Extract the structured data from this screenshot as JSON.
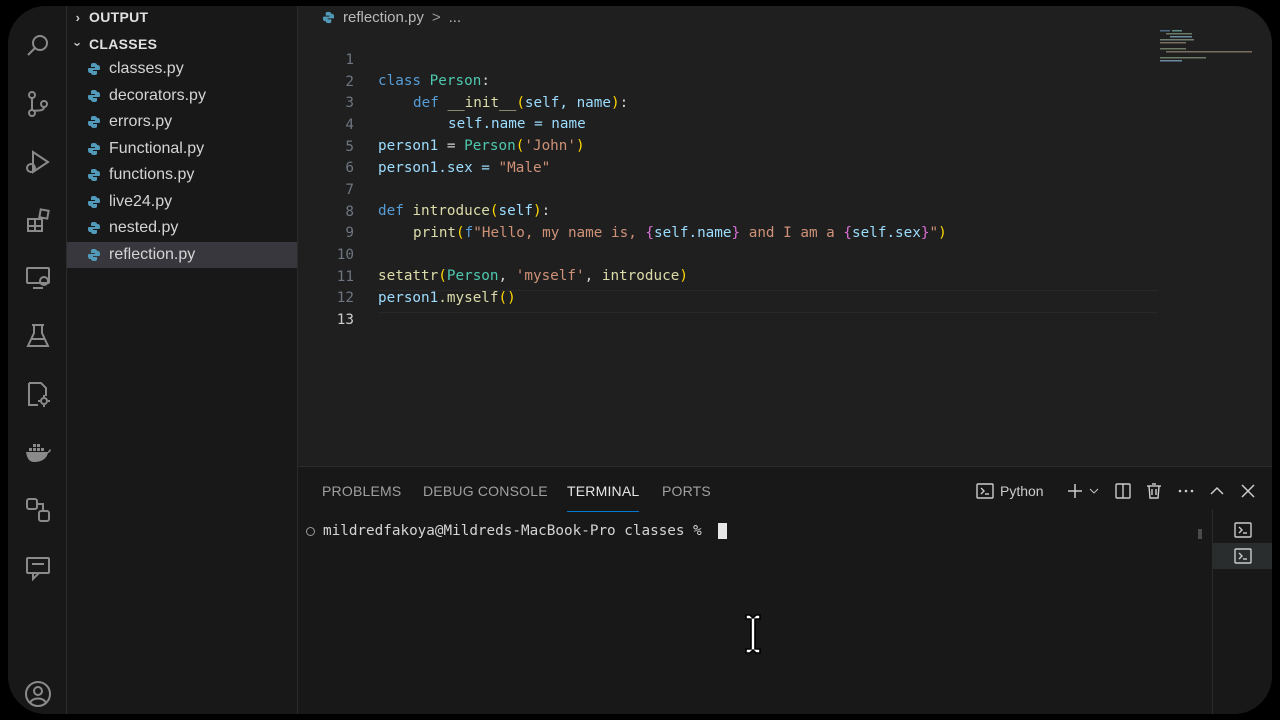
{
  "colors": {
    "background": "#1f1f1f",
    "sidebar": "#181818",
    "selection": "#37373d",
    "accent": "#0078d4",
    "python_icon": "#519aba"
  },
  "activity_bar": {
    "icons": [
      "search-icon",
      "source-control-icon",
      "run-debug-icon",
      "extensions-icon",
      "remote-explorer-icon",
      "testing-icon",
      "settings-sync-icon",
      "docker-icon",
      "live-share-icon",
      "chat-icon",
      "account-icon"
    ]
  },
  "sidebar": {
    "sections": [
      {
        "label": "OUTPUT",
        "expanded": false
      },
      {
        "label": "CLASSES",
        "expanded": true
      }
    ],
    "files": [
      {
        "label": "classes.py"
      },
      {
        "label": "decorators.py"
      },
      {
        "label": "errors.py"
      },
      {
        "label": "Functional.py"
      },
      {
        "label": "functions.py"
      },
      {
        "label": "live24.py"
      },
      {
        "label": "nested.py"
      },
      {
        "label": "reflection.py",
        "active": true
      }
    ]
  },
  "editor": {
    "breadcrumb": {
      "file": "reflection.py",
      "sep": ">",
      "rest": "..."
    },
    "line_numbers": [
      "1",
      "2",
      "3",
      "4",
      "5",
      "6",
      "7",
      "8",
      "9",
      "10",
      "11",
      "12",
      "13"
    ],
    "current_line": "13",
    "code": {
      "l1_kw": "class",
      "l1_cls": "Person",
      "l1_colon": ":",
      "l2_kw": "def",
      "l2_fn": "__init__",
      "l2_params": "self, name",
      "l2_colon": ":",
      "l3_a": "self",
      "l3_b": ".name = name",
      "l4_a": "person1",
      "l4_b": " = ",
      "l4_cls": "Person",
      "l4_str": "'John'",
      "l5_a": "person1",
      "l5_b": ".sex = ",
      "l5_str": "\"Male\"",
      "l7_kw": "def",
      "l7_fn": "introduce",
      "l7_params": "self",
      "l7_colon": ":",
      "l8_fn": "print",
      "l8_f": "f",
      "l8_s1": "\"Hello, my name is, ",
      "l8_v1": "self.name",
      "l8_s2": " and I am a ",
      "l8_v2": "self.sex",
      "l8_s3": "\"",
      "l10_fn": "setattr",
      "l10_cls": "Person",
      "l10_str": "'myself'",
      "l10_arg": "introduce",
      "l11_a": "person1",
      "l11_fn": ".myself"
    }
  },
  "panel": {
    "tabs": [
      {
        "label": "PROBLEMS"
      },
      {
        "label": "DEBUG CONSOLE"
      },
      {
        "label": "TERMINAL",
        "active": true
      },
      {
        "label": "PORTS"
      }
    ],
    "terminal_profile": "Python",
    "prompt": "mildredfakoya@Mildreds-MacBook-Pro classes % "
  }
}
